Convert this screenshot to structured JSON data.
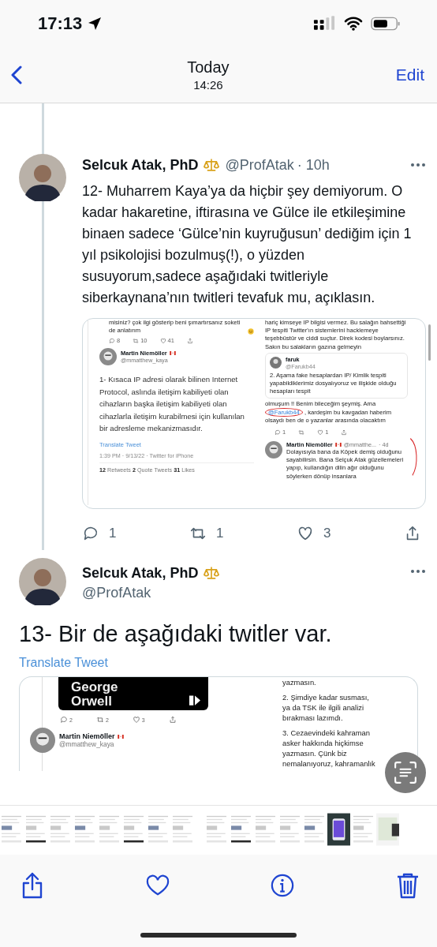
{
  "status_bar": {
    "time": "17:13"
  },
  "nav": {
    "title": "Today",
    "subtitle": "14:26",
    "action": "Edit"
  },
  "tweets": [
    {
      "kind": "reply",
      "name": "Selcuk Atak, PhD",
      "handle": "@ProfAtak",
      "time": "· 10h",
      "text": "12- Muharrem Kaya’ya da hiçbir şey demiyorum. O kadar hakaretine, iftirasına ve Gülce ile etkileşimine binaen sadece ‘Gülce’nin kuyruğusun’ dediğim için 1 yıl psikolojisi bozulmuş(!), o yüzden susuyorum,sadece aşağıdaki twitleriyle siberkaynana’nın twitleri tevafuk mu, açıklasın.",
      "embed": {
        "left": {
          "prev_text": "misiniz? çok ilgi gösterip beni şımartırsanız soketi de anlatırım",
          "prev_actions": [
            {
              "kind": "reply",
              "count": "8"
            },
            {
              "kind": "retweet",
              "count": "10"
            },
            {
              "kind": "like",
              "count": "41"
            },
            {
              "kind": "share"
            }
          ],
          "author": "Martin Niemöller",
          "handle": "@mmatthew_kaya",
          "text": "1- Kısaca IP adresi olarak bilinen Internet Protocol, aslında iletişim kabiliyeti olan cihazların başka iletişim kabiliyeti olan cihazlarla iletişim kurabilmesi için kullanılan bir adresleme mekanizmasıdır.",
          "translate": "Translate Tweet",
          "meta": "1:39 PM · 9/13/22 · Twitter for iPhone",
          "stats": "**12** Retweets **2** Quote Tweets **31** Likes"
        },
        "right": {
          "text": "hariç kimseye IP bilgisi vermez. Bu salağın bahsettiği IP tespiti Twitter'ın sistemlerini hacklemeye teşebbüstür ve ciddi suçtur. Direk kodesi boylarsınız. Sakın bu salakların gazına gelmeyin",
          "quote": {
            "author": "faruk",
            "handle": "@Farukb44",
            "text": "2. Aşama fake hesaplardan IP/ Kimlik tespiti yapabildiklerimiz dosyalıyoruz ve ilişkide olduğu hesapları tespit"
          },
          "reply_before": "olmuşum !! Benim bileceğim şeymiş. Ama",
          "mention": "@Farukb44",
          "reply_after": ", kardeşim bu kavgadan haberim olsaydı ben de o yazanlar arasında olacaktım",
          "reply_actions": [
            {
              "kind": "reply",
              "count": "1"
            },
            {
              "kind": "retweet"
            },
            {
              "kind": "like",
              "count": "1"
            },
            {
              "kind": "share"
            }
          ],
          "next": {
            "author": "Martin Niemöller",
            "handle": "@mmatthe...",
            "time": "· 4d",
            "text": "Dolayısıyla bana da Köpek demiş olduğunu sayabilirsin. Bana Selçuk Atak güzellemeleri yapıp, kullandığın dilin ağır olduğunu söylerken dönüp insanlara"
          }
        }
      },
      "actions": [
        {
          "kind": "reply",
          "count": "1"
        },
        {
          "kind": "retweet",
          "count": "1"
        },
        {
          "kind": "like",
          "count": "3"
        },
        {
          "kind": "share"
        }
      ]
    },
    {
      "kind": "focus",
      "name": "Selcuk Atak, PhD",
      "handle": "@ProfAtak",
      "text": "13- Bir de aşağıdaki twitler var.",
      "translate": "Translate Tweet",
      "embed": {
        "left": {
          "cover_lines": [
            "George",
            "Orwell"
          ],
          "actions": [
            {
              "kind": "reply",
              "count": "2"
            },
            {
              "kind": "retweet",
              "count": "2"
            },
            {
              "kind": "like",
              "count": "3"
            },
            {
              "kind": "share"
            }
          ],
          "author": "Martin Niemöller",
          "handle": "@mmatthew_kaya"
        },
        "right": {
          "lines": [
            "yazmasın.",
            "2. Şimdiye kadar susması, ya da TSK ile ilgili analizi bırakması lazımdı.",
            "3. Cezaevindeki kahraman asker hakkında hiçkimse yazmasın. Çünk biz nemalanıyoruz, kahramanlık"
          ]
        }
      }
    }
  ]
}
